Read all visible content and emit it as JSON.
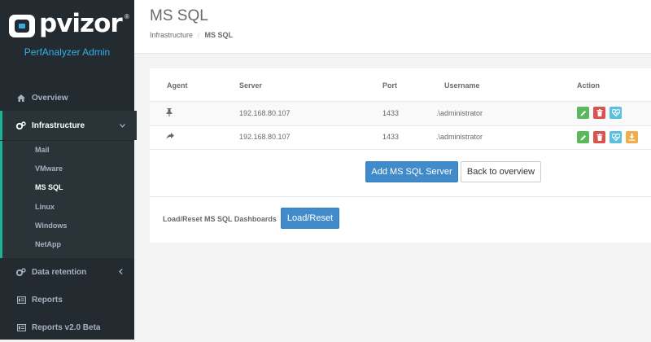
{
  "brand": {
    "logo_text": "pvizor",
    "logo_reg": "®",
    "subtitle": "PerfAnalyzer Admin"
  },
  "sidebar": {
    "items": [
      {
        "label": "Overview",
        "icon": "home-icon"
      },
      {
        "label": "Infrastructure",
        "icon": "cogs-icon",
        "expanded": true
      },
      {
        "label": "Data retention",
        "icon": "cogs-icon"
      },
      {
        "label": "Reports",
        "icon": "report-icon"
      },
      {
        "label": "Reports v2.0 Beta",
        "icon": "report-icon"
      }
    ],
    "subitems": [
      {
        "label": "Mail"
      },
      {
        "label": "VMware"
      },
      {
        "label": "MS SQL",
        "active": true
      },
      {
        "label": "Linux"
      },
      {
        "label": "Windows"
      },
      {
        "label": "NetApp"
      }
    ]
  },
  "header": {
    "title": "MS SQL",
    "breadcrumb": [
      "Infrastructure",
      "MS SQL"
    ],
    "breadcrumb_sep": "/"
  },
  "table": {
    "columns": [
      "Agent",
      "Server",
      "Port",
      "Username",
      "Action"
    ],
    "rows": [
      {
        "agent_icon": "pin-icon",
        "server": "192.168.80.107",
        "port": "1433",
        "username": ".\\administrator"
      },
      {
        "agent_icon": "share-arrow-icon",
        "server": "192.168.80.107",
        "port": "1433",
        "username": ".\\administrator"
      }
    ]
  },
  "buttons": {
    "add": "Add MS SQL Server",
    "back": "Back to overview",
    "load_reset": "Load/Reset"
  },
  "dashboards": {
    "label": "Load/Reset MS SQL Dashboards"
  },
  "colors": {
    "accent": "#1ab394",
    "primary": "#428bca",
    "subtitle": "#35aee6",
    "sidebar": "#232b30"
  }
}
